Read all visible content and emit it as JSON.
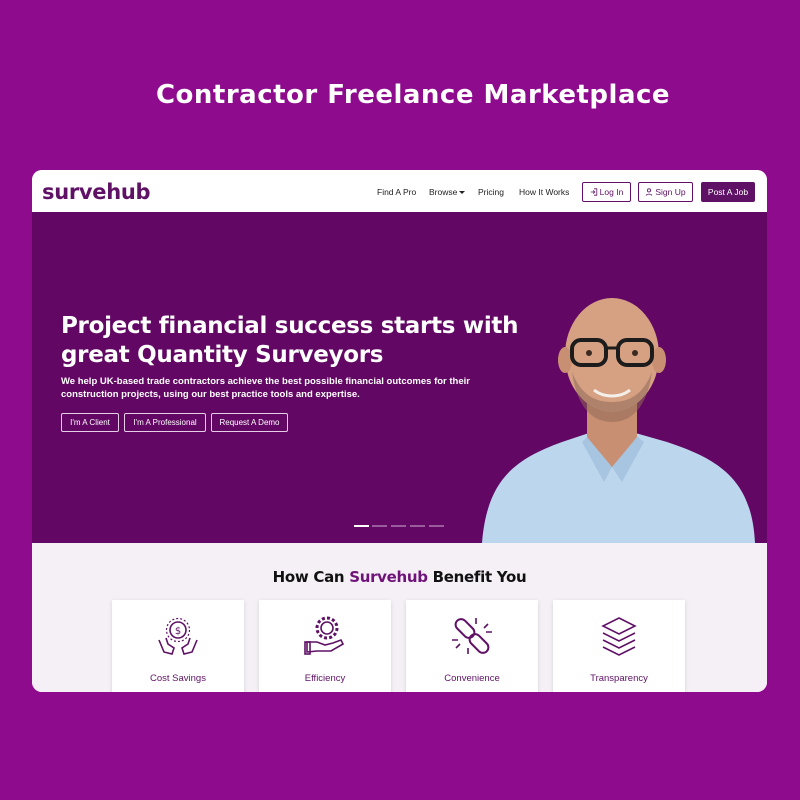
{
  "page_title": "Contractor Freelance Marketplace",
  "nav": {
    "logo": "survehub",
    "links": [
      "Find A Pro",
      "Browse",
      "Pricing",
      "How It Works"
    ],
    "login": "Log In",
    "signup": "Sign Up",
    "post_job": "Post A Job"
  },
  "hero": {
    "title_line1": "Project financial success starts with",
    "title_line2": "great Quantity Surveyors",
    "subtitle_line1": "We help UK-based trade contractors achieve the best possible financial outcomes for their",
    "subtitle_line2": "construction projects, using our best practice tools and expertise.",
    "buttons": [
      "I'm A Client",
      "I'm A Professional",
      "Request A Demo"
    ],
    "slide_count": 5,
    "active_slide": 1
  },
  "benefits": {
    "title_prefix": "How Can ",
    "title_brand": "Survehub",
    "title_suffix": " Benefit You",
    "cards": [
      {
        "label": "Cost Savings",
        "icon": "hands-dollar-icon"
      },
      {
        "label": "Efficiency",
        "icon": "hand-gear-icon"
      },
      {
        "label": "Convenience",
        "icon": "chain-link-icon"
      },
      {
        "label": "Transparency",
        "icon": "layers-icon"
      }
    ]
  },
  "colors": {
    "page_background": "#8e0b8e",
    "brand": "#5f1166",
    "hero_background": "#620763",
    "benefits_background": "#f5eff6"
  }
}
